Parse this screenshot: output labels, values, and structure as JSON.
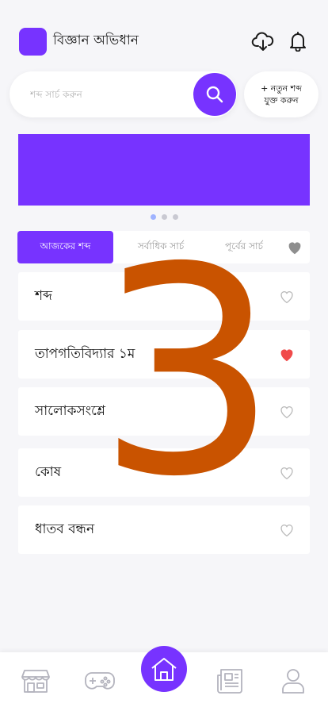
{
  "header": {
    "app_title": "বিজ্ঞান অভিধান",
    "logo_icon": "app-logo",
    "download_icon": "cloud-download-icon",
    "notification_icon": "bell-icon"
  },
  "search": {
    "placeholder": "শব্দ সার্চ করুন",
    "button_icon": "search-icon"
  },
  "add_word_button": {
    "line1": "+ নতুন শব্দ",
    "line2": "যুক্ত করুন"
  },
  "banner": {
    "color": "#7733ff"
  },
  "carousel": {
    "dots": 3,
    "active_index": 0
  },
  "tabs": [
    {
      "label": "আজকের শব্দ",
      "active": true
    },
    {
      "label": "সর্বাধিক সার্চ",
      "active": false
    },
    {
      "label": "পূর্বের সার্চ",
      "active": false
    }
  ],
  "words": [
    {
      "text": "শব্দ",
      "favorite": false
    },
    {
      "text": "তাপগতিবিদ্যার ১ম",
      "favorite": true
    },
    {
      "text": "সালোকসংশ্লে",
      "favorite": false
    },
    {
      "text": "কোষ",
      "favorite": false
    },
    {
      "text": "ধাতব বন্ধন",
      "favorite": false
    }
  ],
  "overlay_number": "3",
  "bottom_nav": [
    {
      "icon": "store-icon"
    },
    {
      "icon": "gamepad-icon"
    },
    {
      "icon": "home-icon",
      "active": true
    },
    {
      "icon": "newspaper-icon"
    },
    {
      "icon": "profile-icon"
    }
  ],
  "colors": {
    "accent": "#7733ff",
    "favorite": "#f04a4a",
    "overlay": "#c95300"
  }
}
